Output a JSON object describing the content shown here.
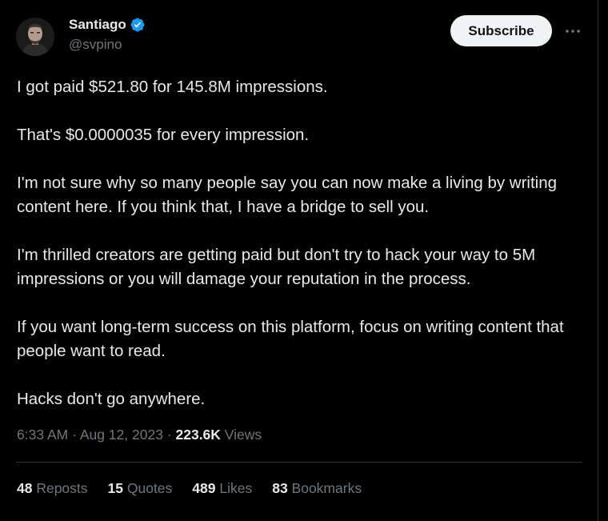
{
  "author": {
    "name": "Santiago",
    "handle": "@svpino",
    "verified_color": "#1d9bf0"
  },
  "header": {
    "subscribe_label": "Subscribe",
    "more_icon": "ellipsis-icon"
  },
  "tweet": {
    "paragraphs": [
      "I got paid $521.80 for 145.8M impressions.",
      "That's $0.0000035 for every impression.",
      "I'm not sure why so many people say you can now make a living by writing content here. If you think that, I have a bridge to sell you.",
      "I'm thrilled creators are getting paid but don't try to hack your way to 5M impressions or you will damage your reputation in the process.",
      "If you want long-term success on this platform, focus on writing content that people want to read.",
      "Hacks don't go anywhere."
    ]
  },
  "meta": {
    "time": "6:33 AM",
    "separator": " · ",
    "date": "Aug 12, 2023",
    "views_count": "223.6K",
    "views_label": " Views"
  },
  "stats": [
    {
      "count": "48",
      "label": " Reposts"
    },
    {
      "count": "15",
      "label": " Quotes"
    },
    {
      "count": "489",
      "label": " Likes"
    },
    {
      "count": "83",
      "label": " Bookmarks"
    }
  ],
  "colors": {
    "background": "#000000",
    "text": "#e7e9ea",
    "muted": "#71767b",
    "border": "#2f3336"
  }
}
